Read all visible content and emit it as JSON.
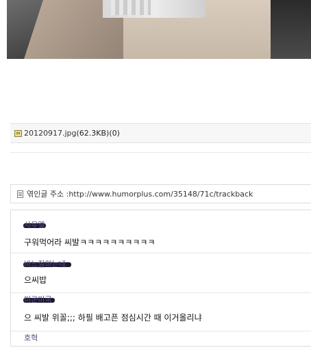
{
  "attachment": {
    "filename": "20120917.jpg",
    "size": "(62.3KB)",
    "count": "(0)"
  },
  "trackback": {
    "label": "엮인글 주소 : ",
    "url": "http://www.humorplus.com/35148/71c/trackback"
  },
  "comments": [
    {
      "author": "사무엘",
      "text": "구워먹어라 씨발ㅋㅋㅋㅋㅋㅋㅋㅋㅋㅋ"
    },
    {
      "author": "바느질하는네",
      "text": "으씨밥"
    },
    {
      "author": "미군미국",
      "text": "으 씨발 위꼴;;; 하필 배고픈 점심시간 때 이거올리냐"
    },
    {
      "author": "호혁",
      "text": ""
    }
  ]
}
